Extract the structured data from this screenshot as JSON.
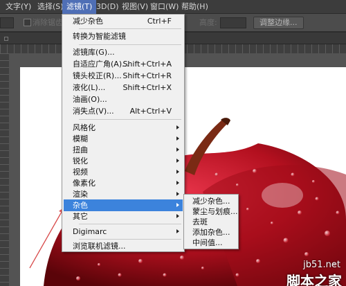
{
  "menubar": {
    "items": [
      {
        "label": "文字(Y)",
        "active": false
      },
      {
        "label": "选择(S)",
        "active": false
      },
      {
        "label": "滤镜(T)",
        "active": true
      },
      {
        "label": "3D(D)",
        "active": false
      },
      {
        "label": "视图(V)",
        "active": false
      },
      {
        "label": "窗口(W)",
        "active": false
      },
      {
        "label": "帮助(H)",
        "active": false
      }
    ]
  },
  "options_bar": {
    "antialias_label": "消除锯齿",
    "height_label": "高度:",
    "refine_edge_button": "调整边缘..."
  },
  "filter_menu": {
    "items": [
      {
        "label": "减少杂色",
        "shortcut": "Ctrl+F"
      },
      {
        "label": "转换为智能滤镜"
      },
      {
        "label": "滤镜库(G)..."
      },
      {
        "label": "自适应广角(A)...",
        "shortcut": "Shift+Ctrl+A"
      },
      {
        "label": "镜头校正(R)...",
        "shortcut": "Shift+Ctrl+R"
      },
      {
        "label": "液化(L)...",
        "shortcut": "Shift+Ctrl+X"
      },
      {
        "label": "油画(O)..."
      },
      {
        "label": "消失点(V)...",
        "shortcut": "Alt+Ctrl+V"
      },
      {
        "label": "风格化"
      },
      {
        "label": "模糊"
      },
      {
        "label": "扭曲"
      },
      {
        "label": "锐化"
      },
      {
        "label": "视频"
      },
      {
        "label": "像素化"
      },
      {
        "label": "渲染"
      },
      {
        "label": "杂色",
        "highlighted": true
      },
      {
        "label": "其它"
      },
      {
        "label": "Digimarc"
      },
      {
        "label": "浏览联机滤镜..."
      }
    ]
  },
  "noise_submenu": {
    "items": [
      {
        "label": "减少杂色..."
      },
      {
        "label": "蒙尘与划痕..."
      },
      {
        "label": "去斑"
      },
      {
        "label": "添加杂色..."
      },
      {
        "label": "中间值..."
      }
    ]
  },
  "watermark": {
    "url": "jb51.net",
    "name": "脚本之家"
  },
  "colors": {
    "menu_highlight": "#3c83dc",
    "active_menu": "#4f6fb6",
    "arrow_annotation": "#d84a4a"
  }
}
